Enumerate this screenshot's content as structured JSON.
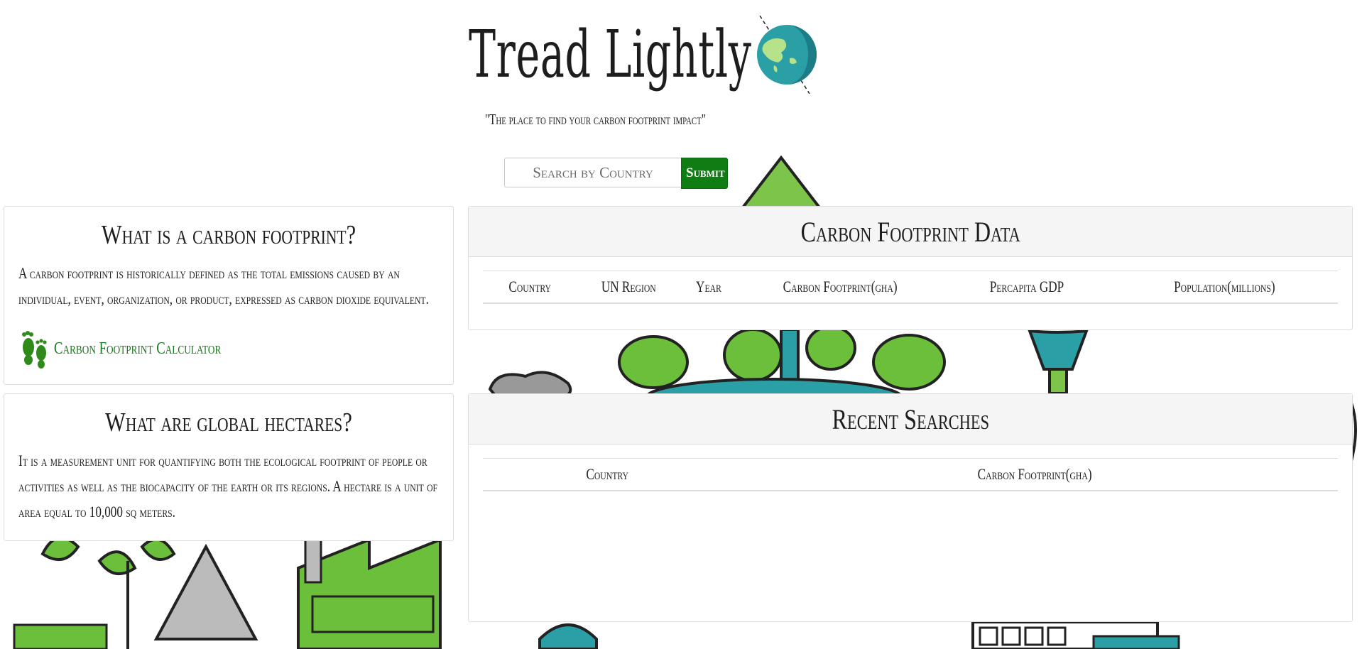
{
  "header": {
    "title": "Tread Lightly",
    "tagline": "\"The place to find your carbon footprint impact\""
  },
  "search": {
    "placeholder": "Search by Country",
    "submit_label": "Submit"
  },
  "info_cards": {
    "carbon": {
      "heading": "What is a carbon footprint?",
      "body": "A carbon footprint is historically defined as the total emissions caused by an individual, event, organization, or product, expressed as carbon dioxide equivalent.",
      "link_label": "Carbon Footprint Calculator"
    },
    "hectares": {
      "heading": "What are global hectares?",
      "body": "It is a measurement unit for quantifying both the ecological footprint of people or activities as well as the biocapacity of the earth or its regions. A hectare is a unit of area equal to 10,000 sq meters."
    }
  },
  "data_panel": {
    "heading": "Carbon Footprint Data",
    "columns": [
      "Country",
      "UN Region",
      "Year",
      "Carbon Footprint(gha)",
      "Percapita GDP",
      "Population(millions)"
    ]
  },
  "recent_panel": {
    "heading": "Recent Searches",
    "columns": [
      "Country",
      "Carbon Footprint(gha)"
    ]
  },
  "colors": {
    "submit_green": "#0f7d14",
    "link_green": "#187a1c",
    "leaf_green": "#6cbf3a",
    "teal": "#2a9fa6"
  }
}
